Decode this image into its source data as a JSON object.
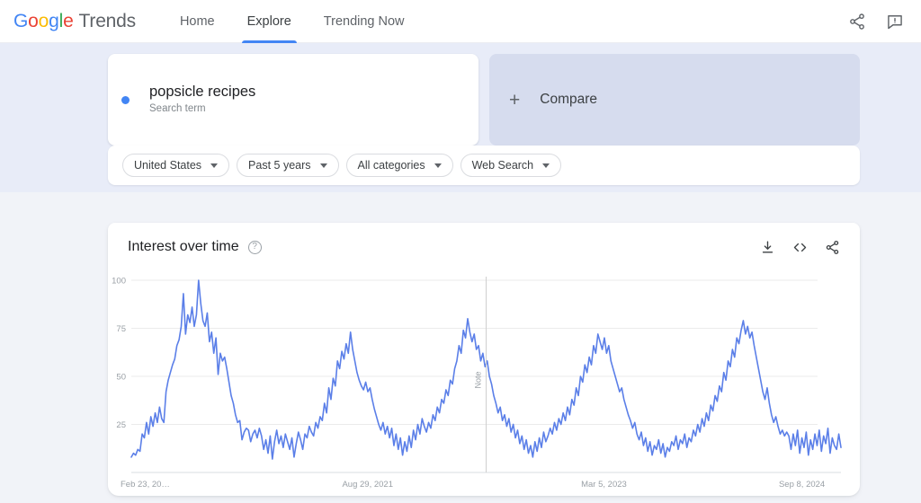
{
  "header": {
    "logo": {
      "word": "Google",
      "letters": [
        "G",
        "o",
        "o",
        "g",
        "l",
        "e"
      ],
      "product": "Trends"
    },
    "nav": [
      {
        "label": "Home",
        "active": false
      },
      {
        "label": "Explore",
        "active": true
      },
      {
        "label": "Trending Now",
        "active": false
      }
    ],
    "actions": [
      {
        "name": "share-icon",
        "label": "Share"
      },
      {
        "name": "feedback-icon",
        "label": "Send feedback"
      }
    ]
  },
  "search": {
    "term": "popsicle recipes",
    "type_label": "Search term",
    "dot_color": "#4285F4",
    "compare_label": "Compare",
    "compare_plus": "+"
  },
  "filters": [
    {
      "name": "region-filter",
      "value": "United States"
    },
    {
      "name": "time-filter",
      "value": "Past 5 years"
    },
    {
      "name": "category-filter",
      "value": "All categories"
    },
    {
      "name": "search-type-filter",
      "value": "Web Search"
    }
  ],
  "chart_card": {
    "title": "Interest over time",
    "help_glyph": "?",
    "actions": [
      {
        "name": "download-icon",
        "label": "Download CSV"
      },
      {
        "name": "embed-icon",
        "label": "Embed"
      },
      {
        "name": "share-icon",
        "label": "Share"
      }
    ]
  },
  "chart_data": {
    "type": "line",
    "title": "Interest over time",
    "xlabel": "",
    "ylabel": "",
    "ylim": [
      0,
      100
    ],
    "yticks": [
      25,
      50,
      75,
      100
    ],
    "grid": true,
    "legend": "none",
    "line_color": "#5B7FE8",
    "xtick_labels": [
      "Feb 23, 20…",
      "Aug 29, 2021",
      "Mar 5, 2023",
      "Sep 8, 2024"
    ],
    "xtick_positions": [
      0,
      0.333,
      0.666,
      0.945
    ],
    "annotations": [
      {
        "name": "note-marker",
        "label": "Note",
        "x": 0.5
      }
    ],
    "series": [
      {
        "name": "popsicle recipes",
        "values": [
          8,
          10,
          9,
          12,
          11,
          20,
          18,
          26,
          20,
          29,
          24,
          31,
          26,
          34,
          28,
          26,
          42,
          48,
          52,
          56,
          59,
          66,
          69,
          76,
          93,
          72,
          82,
          78,
          86,
          76,
          82,
          100,
          88,
          79,
          76,
          83,
          68,
          73,
          62,
          70,
          51,
          62,
          58,
          60,
          54,
          47,
          40,
          36,
          30,
          26,
          27,
          17,
          21,
          23,
          22,
          16,
          20,
          22,
          18,
          23,
          19,
          12,
          17,
          10,
          19,
          7,
          16,
          22,
          15,
          19,
          13,
          20,
          16,
          12,
          18,
          8,
          15,
          21,
          17,
          12,
          20,
          18,
          24,
          21,
          19,
          26,
          23,
          29,
          27,
          36,
          31,
          44,
          38,
          49,
          45,
          58,
          54,
          63,
          59,
          67,
          62,
          73,
          64,
          58,
          52,
          48,
          45,
          43,
          47,
          42,
          44,
          38,
          33,
          29,
          25,
          22,
          26,
          20,
          24,
          18,
          23,
          14,
          20,
          12,
          18,
          9,
          16,
          11,
          19,
          13,
          22,
          17,
          25,
          20,
          28,
          24,
          21,
          26,
          23,
          30,
          27,
          34,
          31,
          38,
          36,
          43,
          40,
          48,
          46,
          54,
          58,
          66,
          62,
          74,
          70,
          80,
          73,
          68,
          72,
          64,
          66,
          58,
          62,
          55,
          58,
          50,
          46,
          40,
          36,
          31,
          34,
          27,
          30,
          24,
          28,
          21,
          25,
          18,
          22,
          15,
          19,
          12,
          17,
          10,
          14,
          8,
          16,
          11,
          18,
          13,
          21,
          16,
          19,
          23,
          20,
          26,
          22,
          28,
          25,
          31,
          27,
          34,
          30,
          38,
          35,
          44,
          40,
          50,
          47,
          56,
          52,
          60,
          56,
          66,
          62,
          72,
          68,
          64,
          70,
          62,
          66,
          58,
          54,
          50,
          46,
          42,
          44,
          38,
          34,
          30,
          27,
          23,
          26,
          20,
          17,
          21,
          14,
          18,
          11,
          16,
          9,
          14,
          12,
          17,
          10,
          15,
          8,
          13,
          11,
          16,
          14,
          19,
          12,
          17,
          15,
          20,
          13,
          18,
          16,
          22,
          19,
          25,
          21,
          28,
          24,
          31,
          27,
          35,
          32,
          40,
          37,
          45,
          42,
          52,
          48,
          58,
          55,
          64,
          60,
          70,
          67,
          74,
          79,
          72,
          76,
          70,
          73,
          66,
          60,
          54,
          48,
          42,
          38,
          44,
          36,
          30,
          26,
          29,
          24,
          20,
          22,
          19,
          21,
          19,
          12,
          20,
          14,
          22,
          10,
          18,
          13,
          21,
          9,
          17,
          12,
          20,
          14,
          22,
          11,
          19,
          15,
          23,
          10,
          18,
          14,
          12,
          20,
          13
        ]
      }
    ]
  }
}
